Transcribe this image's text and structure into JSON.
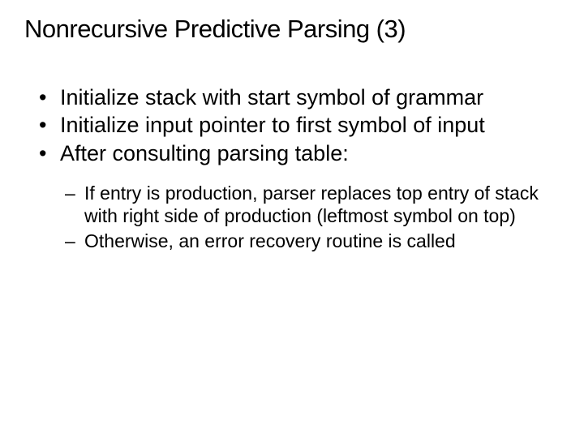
{
  "title": "Nonrecursive Predictive Parsing (3)",
  "bullets": {
    "b1": "Initialize stack with start symbol of grammar",
    "b2": "Initialize input pointer to first symbol of input",
    "b3": "After consulting parsing table:"
  },
  "sub_bullets": {
    "s1": "If entry is production, parser replaces top entry of stack with right side of production (leftmost symbol on top)",
    "s2": "Otherwise, an error recovery routine is called"
  }
}
